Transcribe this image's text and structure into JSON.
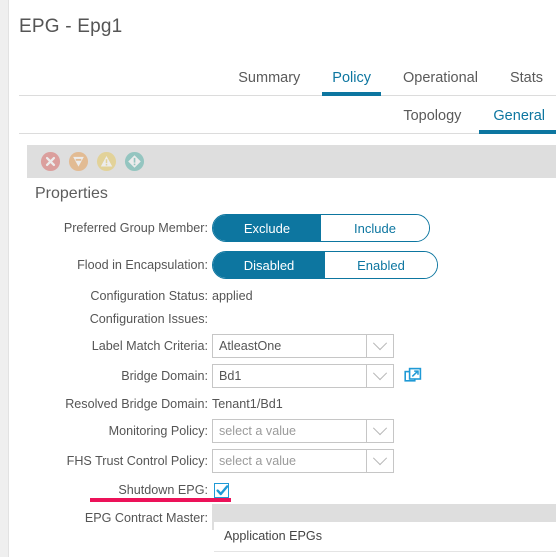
{
  "header": {
    "title": "EPG - Epg1"
  },
  "primary_tabs": [
    {
      "label": "Summary",
      "active": false
    },
    {
      "label": "Policy",
      "active": true
    },
    {
      "label": "Operational",
      "active": false
    },
    {
      "label": "Stats",
      "active": false
    }
  ],
  "secondary_tabs": [
    {
      "label": "Topology",
      "active": false
    },
    {
      "label": "General",
      "active": true
    }
  ],
  "status_icons": [
    {
      "name": "fault-critical-icon",
      "color": "#d9534f",
      "shape": "circle-x"
    },
    {
      "name": "fault-major-icon",
      "color": "#e8913a",
      "shape": "triangle-down-minus"
    },
    {
      "name": "fault-warning-icon",
      "color": "#e8c547",
      "shape": "triangle-warning"
    },
    {
      "name": "fault-minor-icon",
      "color": "#3ba99c",
      "shape": "diamond-exclamation"
    }
  ],
  "properties": {
    "section_title": "Properties",
    "preferred_group_member": {
      "label": "Preferred Group Member:",
      "options": [
        "Exclude",
        "Include"
      ],
      "selected": "Exclude"
    },
    "flood_in_encapsulation": {
      "label": "Flood in Encapsulation:",
      "options": [
        "Disabled",
        "Enabled"
      ],
      "selected": "Disabled"
    },
    "configuration_status": {
      "label": "Configuration Status:",
      "value": "applied"
    },
    "configuration_issues": {
      "label": "Configuration Issues:",
      "value": ""
    },
    "label_match_criteria": {
      "label": "Label Match Criteria:",
      "value": "AtleastOne"
    },
    "bridge_domain": {
      "label": "Bridge Domain:",
      "value": "Bd1"
    },
    "resolved_bridge_domain": {
      "label": "Resolved Bridge Domain:",
      "value": "Tenant1/Bd1"
    },
    "monitoring_policy": {
      "label": "Monitoring Policy:",
      "value": "",
      "placeholder": "select a value"
    },
    "fhs_trust_control_policy": {
      "label": "FHS Trust Control Policy:",
      "value": "",
      "placeholder": "select a value"
    },
    "shutdown_epg": {
      "label": "Shutdown EPG:",
      "checked": true,
      "highlight_color": "#ec1259"
    },
    "epg_contract_master": {
      "label": "EPG Contract Master:",
      "rows": [
        {
          "name": "Application EPGs"
        }
      ]
    }
  },
  "colors": {
    "accent": "#0d76a0",
    "checkbox": "#1f9ad6",
    "annotation": "#ec1259",
    "strip": "#dedede"
  }
}
